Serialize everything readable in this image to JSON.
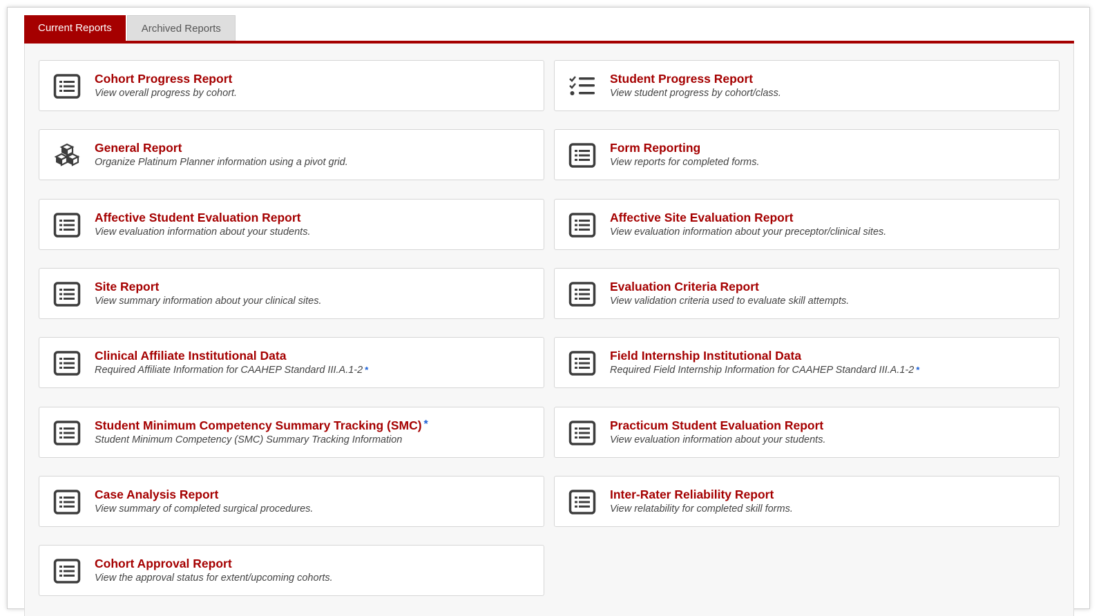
{
  "tabs": [
    {
      "label": "Current Reports",
      "active": true
    },
    {
      "label": "Archived Reports",
      "active": false
    }
  ],
  "colors": {
    "accent": "#a50000",
    "asterisk": "#1a5fd6"
  },
  "reports": [
    {
      "title": "Cohort Progress Report",
      "description": "View overall progress by cohort.",
      "icon": "list-icon"
    },
    {
      "title": "Student Progress Report",
      "description": "View student progress by cohort/class.",
      "icon": "checklist-icon"
    },
    {
      "title": "General Report",
      "description": "Organize Platinum Planner information using a pivot grid.",
      "icon": "cubes-icon"
    },
    {
      "title": "Form Reporting",
      "description": "View reports for completed forms.",
      "icon": "list-icon"
    },
    {
      "title": "Affective Student Evaluation Report",
      "description": "View evaluation information about your students.",
      "icon": "list-icon"
    },
    {
      "title": "Affective Site Evaluation Report",
      "description": "View evaluation information about your preceptor/clinical sites.",
      "icon": "list-icon"
    },
    {
      "title": "Site Report",
      "description": "View summary information about your clinical sites.",
      "icon": "list-icon"
    },
    {
      "title": "Evaluation Criteria Report",
      "description": "View validation criteria used to evaluate skill attempts.",
      "icon": "list-icon"
    },
    {
      "title": "Clinical Affiliate Institutional Data",
      "description": "Required Affiliate Information for CAAHEP Standard III.A.1-2",
      "desc_marker": "*",
      "icon": "list-icon"
    },
    {
      "title": "Field Internship Institutional Data",
      "description": "Required Field Internship Information for CAAHEP Standard III.A.1-2",
      "desc_marker": "*",
      "icon": "list-icon"
    },
    {
      "title": "Student Minimum Competency Summary Tracking (SMC)",
      "title_marker": "*",
      "description": "Student Minimum Competency (SMC) Summary Tracking Information",
      "icon": "list-icon"
    },
    {
      "title": "Practicum Student Evaluation Report",
      "description": "View evaluation information about your students.",
      "icon": "list-icon"
    },
    {
      "title": "Case Analysis Report",
      "description": "View summary of completed surgical procedures.",
      "icon": "list-icon"
    },
    {
      "title": "Inter-Rater Reliability Report",
      "description": "View relatability for completed skill forms.",
      "icon": "list-icon"
    },
    {
      "title": "Cohort Approval Report",
      "description": "View the approval status for extent/upcoming cohorts.",
      "icon": "list-icon"
    }
  ]
}
